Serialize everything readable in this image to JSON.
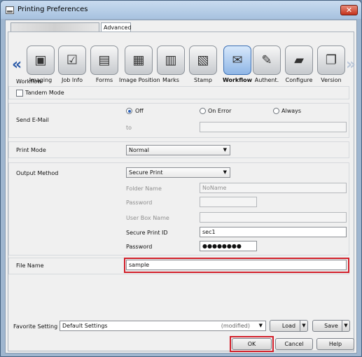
{
  "window": {
    "title": "Printing Preferences",
    "close_glyph": "✕"
  },
  "tabs": {
    "blurred": "",
    "advanced": "Advanced"
  },
  "nav": {
    "left": "«",
    "right": "»"
  },
  "iconbar": [
    {
      "label": "Imaging",
      "icon": "imaging-icon",
      "glyph": "▣"
    },
    {
      "label": "Job Info",
      "icon": "job-info-icon",
      "glyph": "☑"
    },
    {
      "label": "Forms",
      "icon": "forms-icon",
      "glyph": "▤"
    },
    {
      "label": "Image Position",
      "icon": "image-position-icon",
      "glyph": "▦"
    },
    {
      "label": "Marks",
      "icon": "marks-icon",
      "glyph": "▥"
    },
    {
      "label": "Stamp",
      "icon": "stamp-icon",
      "glyph": "▧"
    },
    {
      "label": "Workflow",
      "icon": "workflow-icon",
      "glyph": "✉",
      "active": true
    },
    {
      "label": "Authent.",
      "icon": "authentication-icon",
      "glyph": "✎"
    },
    {
      "label": "Configure",
      "icon": "configure-icon",
      "glyph": "▰"
    },
    {
      "label": "Version",
      "icon": "version-icon",
      "glyph": "❐"
    }
  ],
  "workflow": {
    "header": "Workflow",
    "tandem_mode": "Tandem Mode"
  },
  "send_email": {
    "label": "Send E-Mail",
    "options": [
      "Off",
      "On Error",
      "Always"
    ],
    "selected": "Off",
    "to_label": "to",
    "to_value": ""
  },
  "print_mode": {
    "label": "Print Mode",
    "value": "Normal"
  },
  "output_method": {
    "label": "Output Method",
    "value": "Secure Print",
    "folder_name_label": "Folder Name",
    "folder_name_value": "NoName",
    "password_label": "Password",
    "password_value": "",
    "user_box_label": "User Box Name",
    "user_box_value": "",
    "secure_print_id_label": "Secure Print ID",
    "secure_print_id_value": "sec1",
    "secure_password_label": "Password",
    "secure_password_value": "●●●●●●●●"
  },
  "file_name": {
    "label": "File Name",
    "value": "sample"
  },
  "favorite": {
    "label": "Favorite Setting",
    "value": "Default Settings",
    "modified": "(modified)",
    "load": "Load",
    "save": "Save"
  },
  "footer": {
    "ok": "OK",
    "cancel": "Cancel",
    "help": "Help"
  },
  "colors": {
    "highlight": "#d21f2a",
    "accent": "#2c61b7"
  }
}
